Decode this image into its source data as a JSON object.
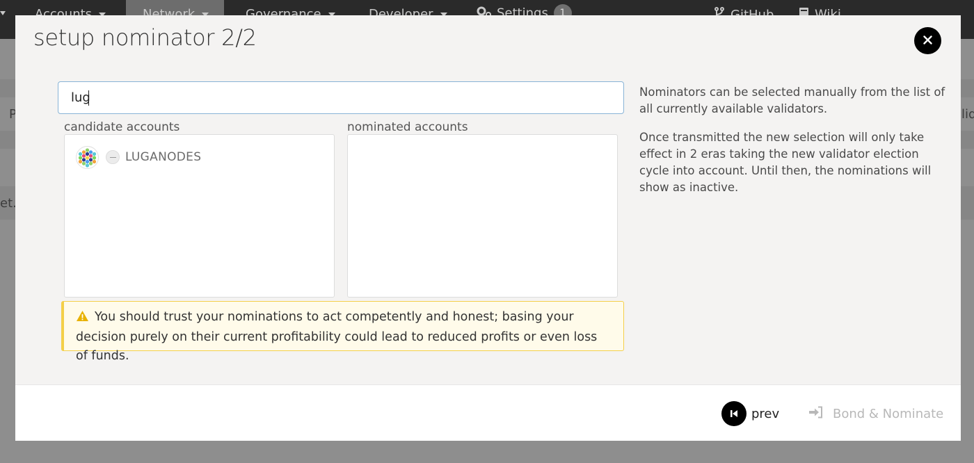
{
  "background": {
    "nav": {
      "accounts": "Accounts",
      "network": "Network",
      "governance": "Governance",
      "developer": "Developer",
      "settings": "Settings",
      "settings_badge": "1",
      "github": "GitHub",
      "wiki": "Wiki"
    },
    "partial_left_1": "P",
    "partial_left_2": "et.",
    "partial_right": "lida"
  },
  "modal": {
    "title": "setup nominator 2/2",
    "search": {
      "value": "lug"
    },
    "candidate_label": "candidate accounts",
    "nominated_label": "nominated accounts",
    "candidates": [
      {
        "name": "LUGANODES"
      }
    ],
    "nominated": [],
    "warning": "You should trust your nominations to act competently and honest; basing your decision purely on their current profitability could lead to reduced profits or even loss of funds.",
    "help": [
      "Nominators can be selected manually from the list of all currently available validators.",
      "Once transmitted the new selection will only take effect in 2 eras taking the new validator election cycle into account. Until then, the nominations will show as inactive."
    ],
    "footer": {
      "prev_label": "prev",
      "bond_label": "Bond & Nominate"
    }
  },
  "colors": {
    "warning_border": "#f4cf48",
    "warning_bg": "#fffbea",
    "input_focus_border": "#88b3d6"
  }
}
